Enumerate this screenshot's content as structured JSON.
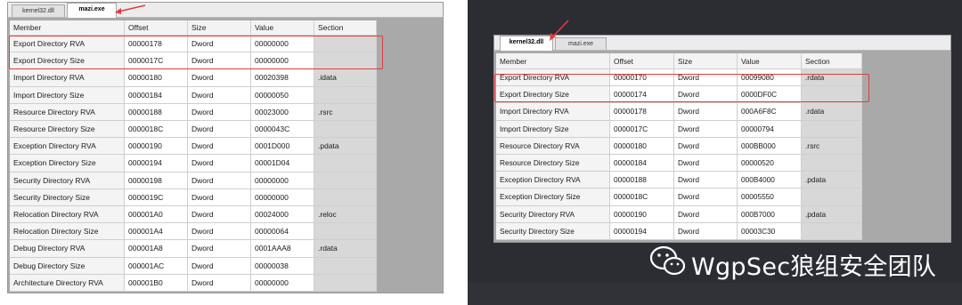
{
  "left_window": {
    "tabs": [
      "kernel32.dll",
      "mazi.exe"
    ],
    "active_tab": 1,
    "columns": [
      "Member",
      "Offset",
      "Size",
      "Value",
      "Section"
    ],
    "rows": [
      [
        "Export Directory RVA",
        "00000178",
        "Dword",
        "00000000",
        ""
      ],
      [
        "Export Directory Size",
        "0000017C",
        "Dword",
        "00000000",
        ""
      ],
      [
        "Import Directory RVA",
        "00000180",
        "Dword",
        "00020398",
        ".idata"
      ],
      [
        "Import Directory Size",
        "00000184",
        "Dword",
        "00000050",
        ""
      ],
      [
        "Resource Directory RVA",
        "00000188",
        "Dword",
        "00023000",
        ".rsrc"
      ],
      [
        "Resource Directory Size",
        "0000018C",
        "Dword",
        "0000043C",
        ""
      ],
      [
        "Exception Directory RVA",
        "00000190",
        "Dword",
        "0001D000",
        ".pdata"
      ],
      [
        "Exception Directory Size",
        "00000194",
        "Dword",
        "00001D04",
        ""
      ],
      [
        "Security Directory RVA",
        "00000198",
        "Dword",
        "00000000",
        ""
      ],
      [
        "Security Directory Size",
        "0000019C",
        "Dword",
        "00000000",
        ""
      ],
      [
        "Relocation Directory RVA",
        "000001A0",
        "Dword",
        "00024000",
        ".reloc"
      ],
      [
        "Relocation Directory Size",
        "000001A4",
        "Dword",
        "00000064",
        ""
      ],
      [
        "Debug Directory RVA",
        "000001A8",
        "Dword",
        "0001AAA8",
        ".rdata"
      ],
      [
        "Debug Directory Size",
        "000001AC",
        "Dword",
        "00000038",
        ""
      ],
      [
        "Architecture Directory RVA",
        "000001B0",
        "Dword",
        "00000000",
        ""
      ]
    ]
  },
  "right_window": {
    "tabs": [
      "kernel32.dll",
      "mazi.exe"
    ],
    "active_tab": 0,
    "columns": [
      "Member",
      "Offset",
      "Size",
      "Value",
      "Section"
    ],
    "rows": [
      [
        "Export Directory RVA",
        "00000170",
        "Dword",
        "00099080",
        ".rdata"
      ],
      [
        "Export Directory Size",
        "00000174",
        "Dword",
        "0000DF0C",
        ""
      ],
      [
        "Import Directory RVA",
        "00000178",
        "Dword",
        "000A6F8C",
        ".rdata"
      ],
      [
        "Import Directory Size",
        "0000017C",
        "Dword",
        "00000794",
        ""
      ],
      [
        "Resource Directory RVA",
        "00000180",
        "Dword",
        "000BB000",
        ".rsrc"
      ],
      [
        "Resource Directory Size",
        "00000184",
        "Dword",
        "00000520",
        ""
      ],
      [
        "Exception Directory RVA",
        "00000188",
        "Dword",
        "000B4000",
        ".pdata"
      ],
      [
        "Exception Directory Size",
        "0000018C",
        "Dword",
        "00005550",
        ""
      ],
      [
        "Security Directory RVA",
        "00000190",
        "Dword",
        "000B7000",
        ".pdata"
      ],
      [
        "Security Directory Size",
        "00000194",
        "Dword",
        "00003C30",
        ""
      ]
    ]
  },
  "watermark": {
    "text": "WgpSec狼组安全团队",
    "icon": "wechat-icon"
  },
  "colors": {
    "highlight": "#e03d3d",
    "dark_bg": "#2b2d33",
    "gray_pane": "#a9a9a9"
  }
}
